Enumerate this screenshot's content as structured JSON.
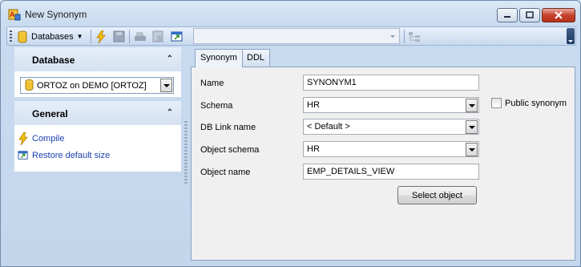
{
  "window": {
    "title": "New Synonym"
  },
  "toolbar": {
    "databases_label": "Databases",
    "combo_value": ""
  },
  "nav": {
    "database_header": "Database",
    "database_value": "ORTOZ on DEMO [ORTOZ]",
    "general_header": "General",
    "items": [
      {
        "label": "Compile",
        "icon": "lightning-icon"
      },
      {
        "label": "Restore default size",
        "icon": "restore-window-icon"
      }
    ]
  },
  "tabs": [
    {
      "label": "Synonym",
      "active": true
    },
    {
      "label": "DDL",
      "active": false
    }
  ],
  "form": {
    "name_label": "Name",
    "name_value": "SYNONYM1",
    "schema_label": "Schema",
    "schema_value": "HR",
    "public_label": "Public synonym",
    "public_checked": false,
    "dblink_label": "DB Link name",
    "dblink_value": "< Default >",
    "object_schema_label": "Object schema",
    "object_schema_value": "HR",
    "object_name_label": "Object name",
    "object_name_value": "EMP_DETAILS_VIEW",
    "select_object_label": "Select object"
  },
  "colors": {
    "link": "#1a3fae",
    "close_button": "#c6422c"
  }
}
